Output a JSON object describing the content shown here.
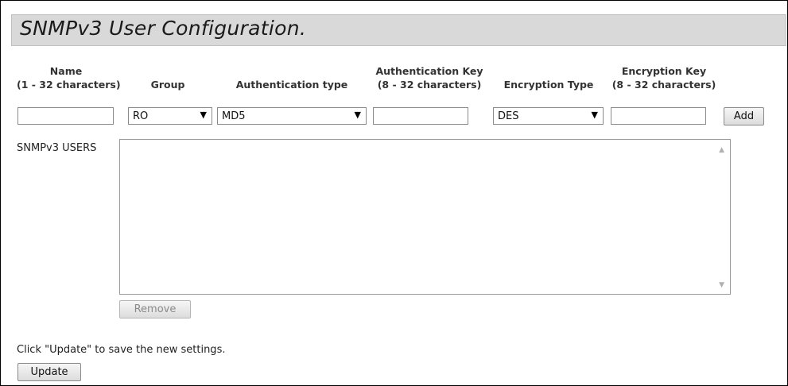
{
  "page": {
    "title": "SNMPv3 User Configuration."
  },
  "headers": {
    "name_line1": "Name",
    "name_line2": "(1 - 32 characters)",
    "group": "Group",
    "auth_type": "Authentication type",
    "auth_key_line1": "Authentication Key",
    "auth_key_line2": "(8 - 32 characters)",
    "enc_type": "Encryption Type",
    "enc_key_line1": "Encryption Key",
    "enc_key_line2": "(8 - 32 characters)"
  },
  "form": {
    "name_value": "",
    "group_value": "RO",
    "auth_type_value": "MD5",
    "auth_key_value": "",
    "enc_type_value": "DES",
    "enc_key_value": "",
    "add_label": "Add",
    "dropdown_arrow": "▼"
  },
  "users": {
    "label": "SNMPv3 USERS",
    "items": [],
    "remove_label": "Remove",
    "scroll_up": "▲",
    "scroll_down": "▼"
  },
  "footer": {
    "hint": "Click \"Update\" to save the new settings.",
    "update_label": "Update"
  },
  "colors": {
    "title_background": "#d9d9d9",
    "border": "#8a8a8a"
  }
}
